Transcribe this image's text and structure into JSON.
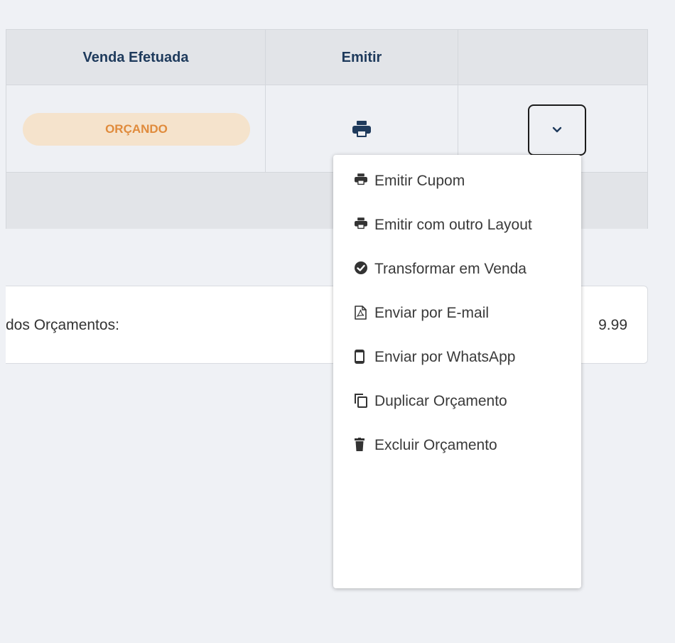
{
  "table": {
    "headers": [
      "Venda Efetuada",
      "Emitir",
      ""
    ],
    "row": {
      "status_badge": "ORÇANDO"
    }
  },
  "summary": {
    "label": "dos Orçamentos:",
    "value_partial": "9.99"
  },
  "dropdown": {
    "items": [
      {
        "label": "Emitir Cupom",
        "icon": "print-icon"
      },
      {
        "label": "Emitir com outro Layout",
        "icon": "print-icon"
      },
      {
        "label": "Transformar em Venda",
        "icon": "check-circle-icon"
      },
      {
        "label": "Enviar por E-mail",
        "icon": "pdf-file-icon"
      },
      {
        "label": "Enviar por WhatsApp",
        "icon": "mobile-icon"
      },
      {
        "label": "Duplicar Orçamento",
        "icon": "copy-icon"
      },
      {
        "label": "Excluir Orçamento",
        "icon": "trash-icon"
      }
    ]
  },
  "colors": {
    "header_text": "#1e3a5c",
    "badge_bg": "#f5e3cc",
    "badge_text": "#e08b3c",
    "print_icon": "#1e3a5c"
  }
}
